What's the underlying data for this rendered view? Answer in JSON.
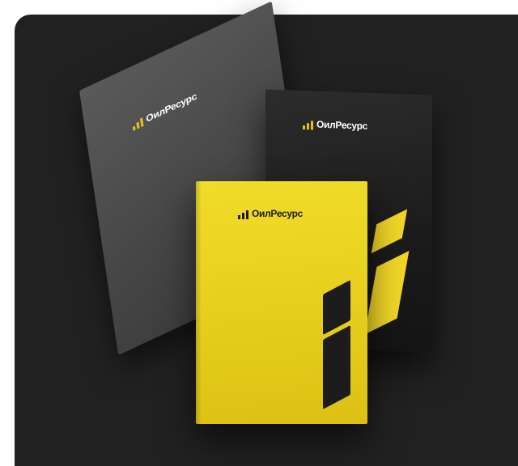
{
  "scene": {
    "description_free": true,
    "background_color": "#212121",
    "book_colors": {
      "left": "#4b4b4b",
      "right": "#1b1b1b",
      "front": "#e8cf1e",
      "accent": "#e6c21e"
    }
  },
  "books": [
    {
      "name": "left-grey-book",
      "brand": "ОилРесурс"
    },
    {
      "name": "right-black-book",
      "brand": "ОилРесурс"
    },
    {
      "name": "front-yellow-book",
      "brand": "ОилРесурс"
    }
  ]
}
